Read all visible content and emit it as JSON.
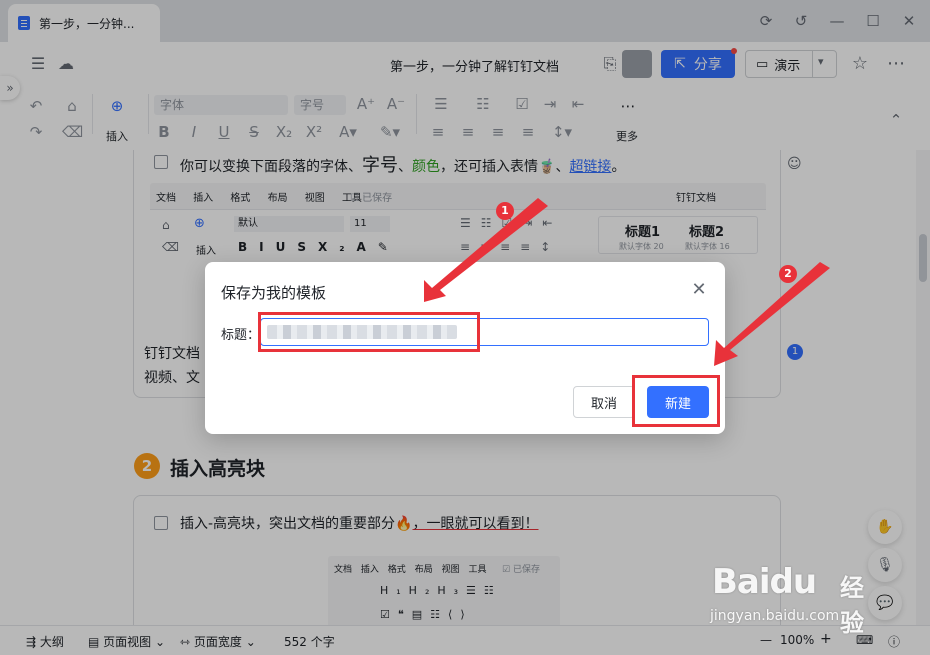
{
  "window": {
    "tab_title": "第一步，一分钟..."
  },
  "header": {
    "doc_title": "第一步，一分钟了解钉钉文档",
    "share_label": "分享",
    "present_label": "演示"
  },
  "toolbar": {
    "insert_label": "插入",
    "font_placeholder": "字体",
    "size_placeholder": "字号",
    "more_label": "更多"
  },
  "document": {
    "line1_prefix": "你可以变换下面段落的",
    "line1_font": "字体、",
    "line1_size": "字号",
    "line1_sep": "、",
    "line1_color": "颜色",
    "line1_mid": "，还可插入表情",
    "line1_link": "超链接",
    "line1_end": "。",
    "mini_menu": [
      "文档",
      "插入",
      "格式",
      "布局",
      "视图",
      "工具"
    ],
    "mini_saved": "已保存",
    "mini_doc_title": "钉钉文档",
    "mini_font": "默认",
    "mini_size": "11",
    "mini_insert": "插入",
    "mini_heading1": "标题1",
    "mini_heading1_sub": "默认字体 20",
    "mini_heading2": "标题2",
    "mini_heading2_sub": "默认字体 16",
    "partial_line1": "钉钉文档",
    "partial_line1_tail": "、",
    "partial_line2": "视频、文",
    "section_number": "2",
    "section_title": "插入高亮块",
    "line2_text": "插入-高亮块，突出文档的重要部分",
    "line2_tail": "，一眼就可以看到！",
    "mini2_menu": [
      "文档",
      "插入",
      "格式",
      "布局",
      "视图",
      "工具"
    ],
    "mini2_saved": "已保存",
    "comment_count": "1"
  },
  "statusbar": {
    "outline": "大纲",
    "page_view": "页面视图",
    "page_width": "页面宽度",
    "word_count": "552 个字",
    "zoom": "100%"
  },
  "dialog": {
    "title": "保存为我的模板",
    "field_label": "标题：",
    "cancel": "取消",
    "create": "新建"
  },
  "annotations": {
    "badge1": "1",
    "badge2": "2"
  },
  "watermark": {
    "brand": "Baidu",
    "jingyan": "经验",
    "url": "jingyan.baidu.com"
  },
  "colors": {
    "accent": "#3370ff",
    "annotation": "#e8323a"
  }
}
